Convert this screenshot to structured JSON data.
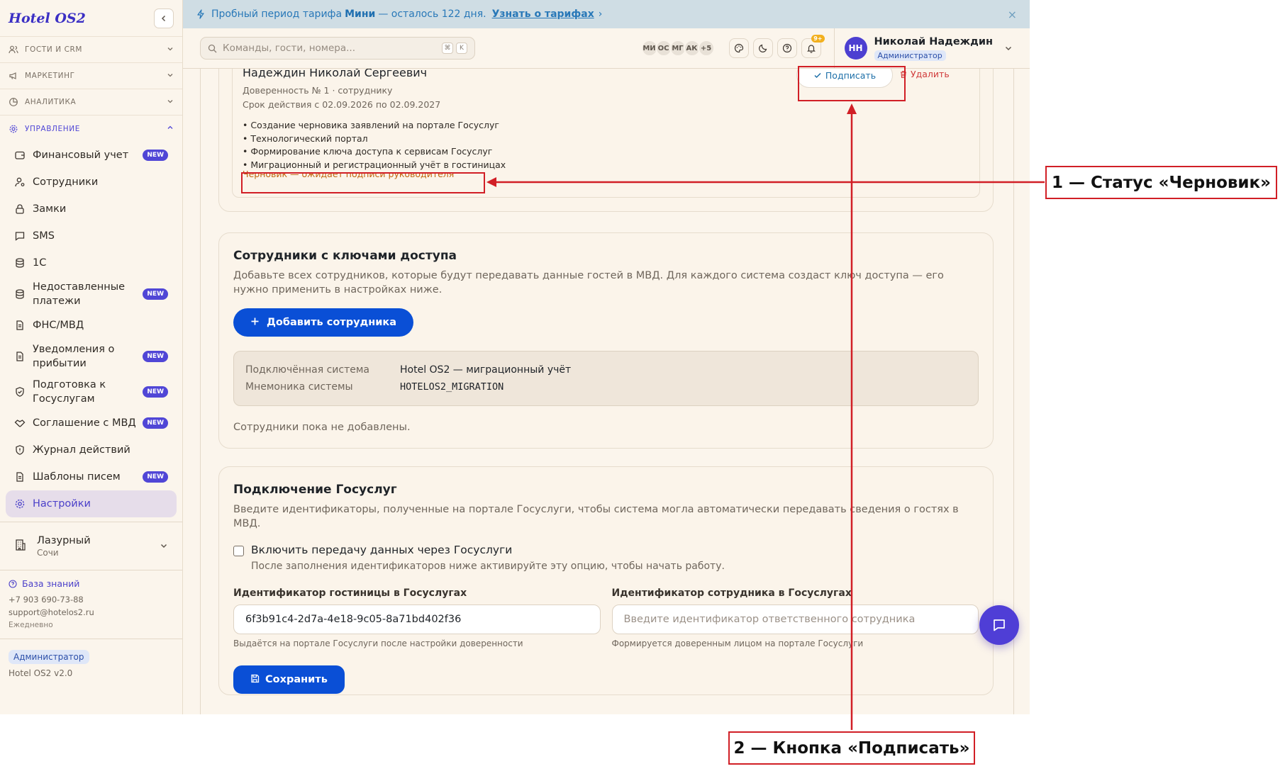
{
  "sidebar": {
    "logo": "Hotel OS2",
    "sections": [
      {
        "label": "ГОСТИ И CRM"
      },
      {
        "label": "МАРКЕТИНГ"
      },
      {
        "label": "АНАЛИТИКА"
      },
      {
        "label": "УПРАВЛЕНИЕ"
      }
    ],
    "items": [
      {
        "label": "Финансовый учет",
        "badge": "NEW"
      },
      {
        "label": "Сотрудники"
      },
      {
        "label": "Замки"
      },
      {
        "label": "SMS"
      },
      {
        "label": "1С"
      },
      {
        "label": "Недоставленные платежи",
        "badge": "NEW"
      },
      {
        "label": "ФНС/МВД"
      },
      {
        "label": "Уведомления о прибытии",
        "badge": "NEW"
      },
      {
        "label": "Подготовка к Госуслугам",
        "badge": "NEW"
      },
      {
        "label": "Соглашение с МВД",
        "badge": "NEW"
      },
      {
        "label": "Журнал действий"
      },
      {
        "label": "Шаблоны писем",
        "badge": "NEW"
      },
      {
        "label": "Настройки"
      }
    ],
    "hotel": {
      "name": "Лазурный",
      "city": "Сочи"
    },
    "support": {
      "kb_label": "База знаний",
      "phone": "+7 903 690-73-88",
      "email": "support@hotelos2.ru",
      "schedule": "Ежедневно"
    },
    "role": "Администратор",
    "version": "Hotel OS2 v2.0"
  },
  "trial": {
    "text_before": "Пробный период тарифа",
    "plan": "Мини",
    "text_after": "— осталось 122 дня.",
    "link": "Узнать о тарифах",
    "link_arrow": "›",
    "close": "×"
  },
  "topbar": {
    "search_placeholder": "Команды, гости, номера...",
    "keys": [
      "⌘",
      "K"
    ],
    "avatars": [
      "МИ",
      "ОС",
      "МГ",
      "АК",
      "+5"
    ],
    "notif_count": "9+",
    "user": {
      "initials": "НН",
      "name": "Николай Надеждин",
      "role": "Администратор"
    }
  },
  "poa": {
    "name": "Надеждин Николай Сергеевич",
    "number": "Доверенность № 1 · сотруднику",
    "validity": "Срок действия с 02.09.2026 по 02.09.2027",
    "scopes": [
      "• Создание черновика заявлений на портале Госуслуг",
      "• Технологический портал",
      "• Формирование ключа доступа к сервисам Госуслуг",
      "• Миграционный и регистрационный учёт в гостиницах"
    ],
    "status": "Черновик — ожидает подписи руководителя",
    "sign_label": "Подписать",
    "delete_label": "Удалить"
  },
  "employees": {
    "title": "Сотрудники с ключами доступа",
    "desc": "Добавьте всех сотрудников, которые будут передавать данные гостей в МВД. Для каждого система создаст ключ доступа — его нужно применить в настройках ниже.",
    "add_label": "Добавить сотрудника",
    "system_key": "Подключённая система",
    "system_value": "Hotel OS2 — миграционный учёт",
    "mnemonic_key": "Мнемоника системы",
    "mnemonic_value": "HOTELOS2_MIGRATION",
    "empty": "Сотрудники пока не добавлены."
  },
  "gosuslugi": {
    "title": "Подключение Госуслуг",
    "desc": "Введите идентификаторы, полученные на портале Госуслуги, чтобы система могла автоматически передавать сведения о гостях в МВД.",
    "enable_label": "Включить передачу данных через Госуслуги",
    "enable_checked": false,
    "enable_hint": "После заполнения идентификаторов ниже активируйте эту опцию, чтобы начать работу.",
    "hotel_id_label": "Идентификатор гостиницы в Госуслугах",
    "hotel_id_value": "6f3b91c4-2d7a-4e18-9c05-8a71bd402f36",
    "hotel_id_hint": "Выдаётся на портале Госуслуги после настройки доверенности",
    "employee_id_label": "Идентификатор сотрудника в Госуслугах",
    "employee_id_placeholder": "Введите идентификатор ответственного сотрудника",
    "employee_id_hint": "Формируется доверенным лицом на портале Госуслуги",
    "save_label": "Сохранить"
  },
  "annotations": {
    "callout1": "1 — Статус «Черновик»",
    "callout2": "2 — Кнопка «Подписать»",
    "color": "#d11f26"
  },
  "colors": {
    "accent": "#5046d6",
    "primary_button": "#0a4fd6",
    "status_draft": "#c0660f",
    "danger": "#d03a3a"
  }
}
